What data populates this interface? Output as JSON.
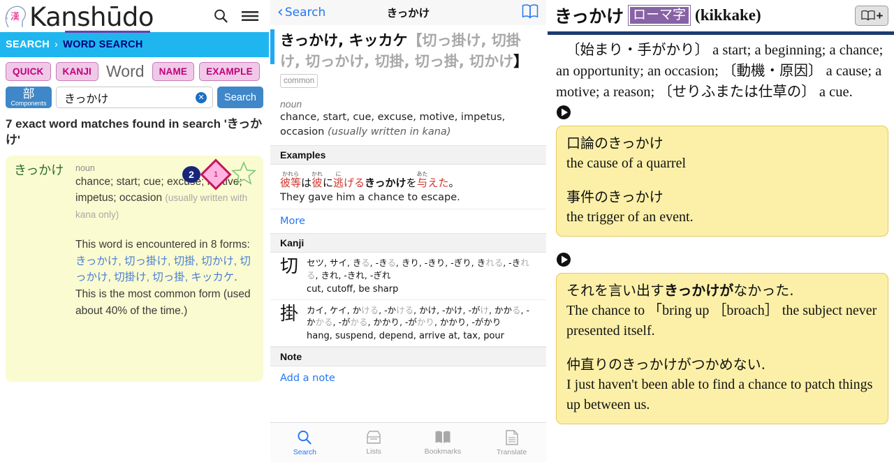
{
  "left": {
    "brand": "Kanshūdo",
    "header_icons": [
      "search-icon",
      "menu-icon"
    ],
    "logo_kanji": "漢",
    "breadcrumb": {
      "root": "SEARCH",
      "separator": "›",
      "current": "WORD SEARCH"
    },
    "tabs": [
      {
        "label": "QUICK",
        "active": false
      },
      {
        "label": "KANJI",
        "active": false
      },
      {
        "label": "Word",
        "active": true
      },
      {
        "label": "NAME",
        "active": false
      },
      {
        "label": "EXAMPLE",
        "active": false
      }
    ],
    "components_button": {
      "kanji": "部",
      "label": "Components"
    },
    "search": {
      "value": "きっかけ",
      "placeholder": "",
      "clear": "✕",
      "button": "Search"
    },
    "results_heading": "7 exact word matches found in search 'きっかけ'",
    "card": {
      "headword": "きっかけ",
      "pos": "noun",
      "meanings": "chance; start; cue; excuse; motive; impetus; occasion ",
      "meaning_note": "(usually written with kana only)",
      "note_pre": "This word is encountered in 8 forms: ",
      "note_forms": "きっかけ, 切っ掛け, 切掛, 切かけ, 切っかけ, 切掛け, 切っ掛, キッカケ",
      "note_post": ". This is the most common form (used about 40% of the time.)",
      "badges": {
        "usefulness": "2",
        "level": "1",
        "star": "star-outline"
      }
    }
  },
  "middle": {
    "nav": {
      "back": "Search",
      "title": "きっかけ",
      "book_icon": "book-icon"
    },
    "entry": {
      "headword_main": "きっかけ, キッカケ",
      "bracket_open": "【",
      "alt_forms": "切っ掛け, 切掛け, 切っかけ, 切掛, 切っ掛, 切かけ",
      "bracket_close": "】",
      "tag": "common",
      "pos": "noun",
      "gloss": "chance, start, cue, excuse, motive, impetus, occasion ",
      "gloss_note": "(usually written in kana)"
    },
    "sections": {
      "examples": "Examples",
      "kanji": "Kanji",
      "note": "Note"
    },
    "example": {
      "tokens": [
        {
          "base": "彼等",
          "ruby": "かれら",
          "red": true
        },
        {
          "base": "は",
          "ruby": "",
          "red": false
        },
        {
          "base": "彼",
          "ruby": "かれ",
          "red": true
        },
        {
          "base": "に",
          "ruby": "",
          "red": false
        },
        {
          "base": "逃",
          "ruby": "に",
          "red": true
        },
        {
          "base": "げる",
          "ruby": "",
          "red": true
        },
        {
          "base": "きっかけ",
          "ruby": "",
          "red": false,
          "bold": true
        },
        {
          "base": "を",
          "ruby": "",
          "red": false
        },
        {
          "base": "与",
          "ruby": "あた",
          "red": true
        },
        {
          "base": "えた",
          "ruby": "",
          "red": true
        },
        {
          "base": "。",
          "ruby": "",
          "red": false
        }
      ],
      "english": "They gave him a chance to escape.",
      "more": "More"
    },
    "kanji_entries": [
      {
        "glyph": "切",
        "readings": "セツ, サイ, き<g>る</g>, -き<g>る</g>, きり, -きり, -ぎり, き<g>れる</g>, -き<g>れる</g>, きれ, -きれ, -ぎれ",
        "meaning": "cut, cutoff, be sharp"
      },
      {
        "glyph": "掛",
        "readings": "カイ, ケイ, か<g>ける</g>, -か<g>ける</g>, かけ, -かけ, -が<g>け</g>, かか<g>る</g>, -か<g>かる</g>, -が<g>かる</g>, かかり, -が<g>かり</g>, かかり, -がかり",
        "meaning": "hang, suspend, depend, arrive at, tax, pour"
      }
    ],
    "note_action": "Add a note",
    "tabbar": [
      {
        "label": "Search",
        "icon": "search-icon",
        "active": true
      },
      {
        "label": "Lists",
        "icon": "lists-icon",
        "active": false
      },
      {
        "label": "Bookmarks",
        "icon": "bookmarks-icon",
        "active": false
      },
      {
        "label": "Translate",
        "icon": "translate-icon",
        "active": false
      }
    ]
  },
  "right": {
    "headword": "きっかけ",
    "romaji_tag": "ローマ字",
    "romaji": "(kikkake)",
    "add_book_button": "book-plus-icon",
    "definition": "〔始まり・手がかり〕 a start; a beginning; a chance; an opportunity; an occasion; 〔動機・原因〕 a cause; a motive; a reason; 〔せりふまたは仕草の〕 a cue.",
    "examples": [
      {
        "play": "play-icon",
        "lines": [
          {
            "jp": "口論のきっかけ",
            "en": "the cause of a quarrel"
          },
          {
            "jp": "事件のきっかけ",
            "en": "the trigger of an event."
          }
        ]
      },
      {
        "play": "play-icon",
        "lines": [
          {
            "jp_pre": "それを言い出す",
            "jp_bold": "きっかけが",
            "jp_post": "なかった.",
            "en": "The chance to 「bring up ［broach］ the subject never presented itself."
          },
          {
            "jp_pre": "仲直りのきっかけがつかめない.",
            "jp_bold": "",
            "jp_post": "",
            "en": "I just haven't been able to find a chance to patch things up between us."
          }
        ]
      }
    ]
  },
  "colors": {
    "breadcrumb_bg": "#1fb6ef",
    "pill_bg": "#f0c9e8",
    "pill_text": "#c0007a",
    "blue_button": "#3f87c8",
    "ios_blue": "#2477f2",
    "card_yellow": "#fafbd0",
    "example_yellow": "#fcf0a8",
    "navy_rule": "#1b3b6f",
    "purple_tag": "#8762a5"
  }
}
